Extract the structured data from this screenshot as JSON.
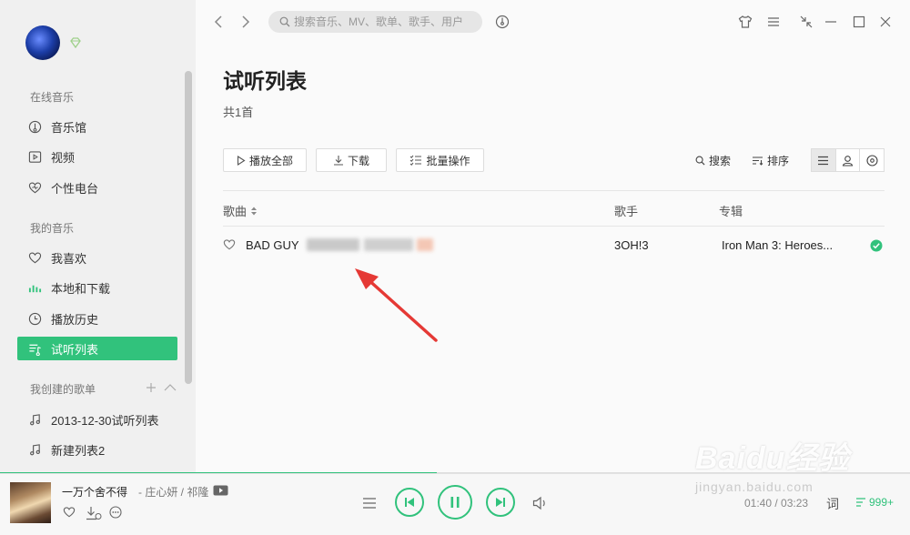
{
  "sidebar": {
    "sections": {
      "online": "在线音乐",
      "mine": "我的音乐",
      "created": "我创建的歌单"
    },
    "online_items": [
      {
        "label": "音乐馆",
        "icon": "music-hall-icon"
      },
      {
        "label": "视频",
        "icon": "video-icon"
      },
      {
        "label": "个性电台",
        "icon": "radio-heart-icon"
      }
    ],
    "my_items": [
      {
        "label": "我喜欢",
        "icon": "heart-icon"
      },
      {
        "label": "本地和下载",
        "icon": "equalizer-icon"
      },
      {
        "label": "播放历史",
        "icon": "clock-icon"
      },
      {
        "label": "试听列表",
        "icon": "playlist-icon",
        "active": true
      }
    ],
    "playlists": [
      {
        "label": "2013-12-30试听列表",
        "icon": "music-note-icon"
      },
      {
        "label": "新建列表2",
        "icon": "music-note-icon"
      }
    ]
  },
  "topbar": {
    "search_placeholder": "搜索音乐、MV、歌单、歌手、用户"
  },
  "main": {
    "title": "试听列表",
    "count": "共1首",
    "buttons": {
      "play_all": "播放全部",
      "download": "下载",
      "batch": "批量操作"
    },
    "tools": {
      "search": "搜索",
      "sort": "排序"
    },
    "columns": {
      "song": "歌曲",
      "artist": "歌手",
      "album": "专辑"
    },
    "rows": [
      {
        "song": "BAD GUY",
        "artist": "3OH!3",
        "album": "Iron Man 3: Heroes...",
        "downloaded": true
      }
    ]
  },
  "player": {
    "title": "一万个舍不得",
    "artist": "- 庄心妍 / 祁隆",
    "time": "01:40 / 03:23",
    "lyric": "词",
    "count": "999+",
    "progress": 0.48
  },
  "watermark": {
    "text": "Baidu经验",
    "sub": "jingyan.baidu.com"
  },
  "colors": {
    "accent": "#31c27c",
    "arrow": "#e53935"
  }
}
